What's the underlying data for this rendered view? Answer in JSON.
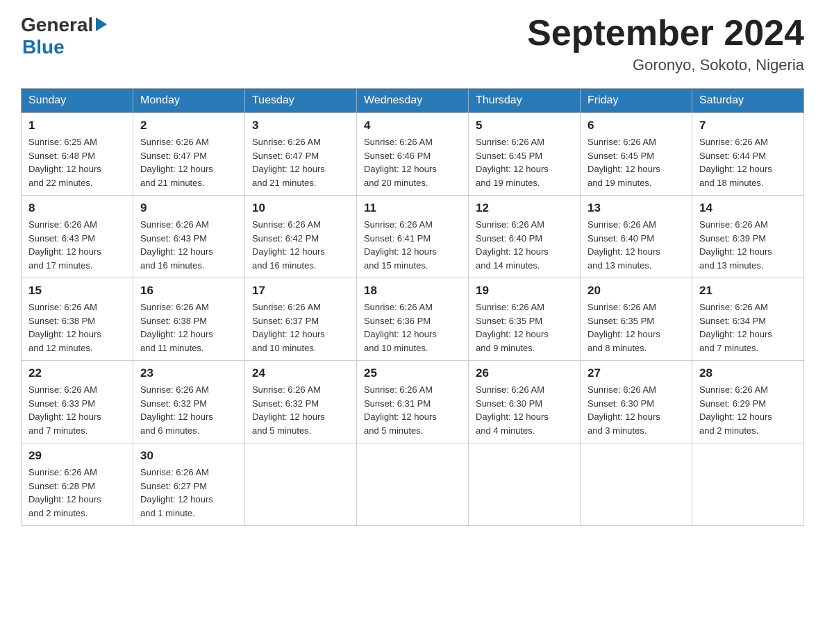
{
  "header": {
    "logo_general": "General",
    "logo_blue": "Blue",
    "title": "September 2024",
    "location": "Goronyo, Sokoto, Nigeria"
  },
  "days_of_week": [
    "Sunday",
    "Monday",
    "Tuesday",
    "Wednesday",
    "Thursday",
    "Friday",
    "Saturday"
  ],
  "weeks": [
    [
      {
        "day": "1",
        "sunrise": "6:25 AM",
        "sunset": "6:48 PM",
        "daylight": "12 hours and 22 minutes."
      },
      {
        "day": "2",
        "sunrise": "6:26 AM",
        "sunset": "6:47 PM",
        "daylight": "12 hours and 21 minutes."
      },
      {
        "day": "3",
        "sunrise": "6:26 AM",
        "sunset": "6:47 PM",
        "daylight": "12 hours and 21 minutes."
      },
      {
        "day": "4",
        "sunrise": "6:26 AM",
        "sunset": "6:46 PM",
        "daylight": "12 hours and 20 minutes."
      },
      {
        "day": "5",
        "sunrise": "6:26 AM",
        "sunset": "6:45 PM",
        "daylight": "12 hours and 19 minutes."
      },
      {
        "day": "6",
        "sunrise": "6:26 AM",
        "sunset": "6:45 PM",
        "daylight": "12 hours and 19 minutes."
      },
      {
        "day": "7",
        "sunrise": "6:26 AM",
        "sunset": "6:44 PM",
        "daylight": "12 hours and 18 minutes."
      }
    ],
    [
      {
        "day": "8",
        "sunrise": "6:26 AM",
        "sunset": "6:43 PM",
        "daylight": "12 hours and 17 minutes."
      },
      {
        "day": "9",
        "sunrise": "6:26 AM",
        "sunset": "6:43 PM",
        "daylight": "12 hours and 16 minutes."
      },
      {
        "day": "10",
        "sunrise": "6:26 AM",
        "sunset": "6:42 PM",
        "daylight": "12 hours and 16 minutes."
      },
      {
        "day": "11",
        "sunrise": "6:26 AM",
        "sunset": "6:41 PM",
        "daylight": "12 hours and 15 minutes."
      },
      {
        "day": "12",
        "sunrise": "6:26 AM",
        "sunset": "6:40 PM",
        "daylight": "12 hours and 14 minutes."
      },
      {
        "day": "13",
        "sunrise": "6:26 AM",
        "sunset": "6:40 PM",
        "daylight": "12 hours and 13 minutes."
      },
      {
        "day": "14",
        "sunrise": "6:26 AM",
        "sunset": "6:39 PM",
        "daylight": "12 hours and 13 minutes."
      }
    ],
    [
      {
        "day": "15",
        "sunrise": "6:26 AM",
        "sunset": "6:38 PM",
        "daylight": "12 hours and 12 minutes."
      },
      {
        "day": "16",
        "sunrise": "6:26 AM",
        "sunset": "6:38 PM",
        "daylight": "12 hours and 11 minutes."
      },
      {
        "day": "17",
        "sunrise": "6:26 AM",
        "sunset": "6:37 PM",
        "daylight": "12 hours and 10 minutes."
      },
      {
        "day": "18",
        "sunrise": "6:26 AM",
        "sunset": "6:36 PM",
        "daylight": "12 hours and 10 minutes."
      },
      {
        "day": "19",
        "sunrise": "6:26 AM",
        "sunset": "6:35 PM",
        "daylight": "12 hours and 9 minutes."
      },
      {
        "day": "20",
        "sunrise": "6:26 AM",
        "sunset": "6:35 PM",
        "daylight": "12 hours and 8 minutes."
      },
      {
        "day": "21",
        "sunrise": "6:26 AM",
        "sunset": "6:34 PM",
        "daylight": "12 hours and 7 minutes."
      }
    ],
    [
      {
        "day": "22",
        "sunrise": "6:26 AM",
        "sunset": "6:33 PM",
        "daylight": "12 hours and 7 minutes."
      },
      {
        "day": "23",
        "sunrise": "6:26 AM",
        "sunset": "6:32 PM",
        "daylight": "12 hours and 6 minutes."
      },
      {
        "day": "24",
        "sunrise": "6:26 AM",
        "sunset": "6:32 PM",
        "daylight": "12 hours and 5 minutes."
      },
      {
        "day": "25",
        "sunrise": "6:26 AM",
        "sunset": "6:31 PM",
        "daylight": "12 hours and 5 minutes."
      },
      {
        "day": "26",
        "sunrise": "6:26 AM",
        "sunset": "6:30 PM",
        "daylight": "12 hours and 4 minutes."
      },
      {
        "day": "27",
        "sunrise": "6:26 AM",
        "sunset": "6:30 PM",
        "daylight": "12 hours and 3 minutes."
      },
      {
        "day": "28",
        "sunrise": "6:26 AM",
        "sunset": "6:29 PM",
        "daylight": "12 hours and 2 minutes."
      }
    ],
    [
      {
        "day": "29",
        "sunrise": "6:26 AM",
        "sunset": "6:28 PM",
        "daylight": "12 hours and 2 minutes."
      },
      {
        "day": "30",
        "sunrise": "6:26 AM",
        "sunset": "6:27 PM",
        "daylight": "12 hours and 1 minute."
      },
      null,
      null,
      null,
      null,
      null
    ]
  ],
  "labels": {
    "sunrise": "Sunrise:",
    "sunset": "Sunset:",
    "daylight": "Daylight:"
  }
}
